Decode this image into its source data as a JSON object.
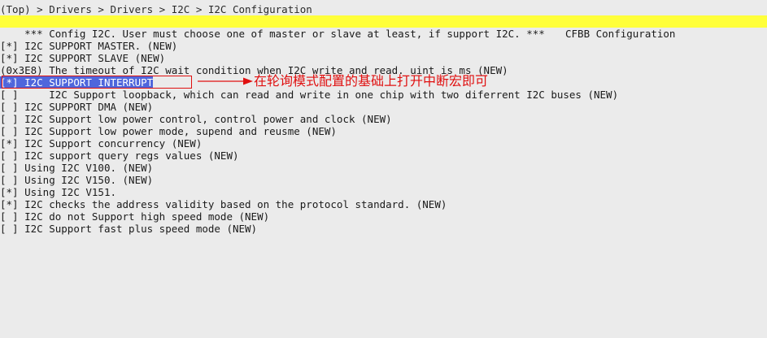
{
  "breadcrumb": "(Top) > Drivers > Drivers > I2C > I2C Configuration",
  "window_title": "CFBB Configuration",
  "items": [
    {
      "prefix": "    ",
      "text": "*** Config I2C. User must choose one of master or slave at least, if support I2C. ***"
    },
    {
      "prefix": "[*] ",
      "text": "I2C SUPPORT MASTER. (NEW)"
    },
    {
      "prefix": "[*] ",
      "text": "I2C SUPPORT SLAVE (NEW)"
    },
    {
      "prefix": "(0x3E8) ",
      "text": "The timeout of I2C wait condition when I2C write and read. uint is ms (NEW)"
    },
    {
      "prefix": "[*] ",
      "text": "I2C SUPPORT INTERRUPT"
    },
    {
      "prefix": "[ ]     ",
      "text": "I2C Support loopback, which can read and write in one chip with two diferrent I2C buses (NEW)"
    },
    {
      "prefix": "[ ] ",
      "text": "I2C SUPPORT DMA (NEW)"
    },
    {
      "prefix": "[ ] ",
      "text": "I2C Support low power control, control power and clock (NEW)"
    },
    {
      "prefix": "[ ] ",
      "text": "I2C Support low power mode, supend and reusme (NEW)"
    },
    {
      "prefix": "[*] ",
      "text": "I2C Support concurrency (NEW)"
    },
    {
      "prefix": "[ ] ",
      "text": "I2C support query regs values (NEW)"
    },
    {
      "prefix": "[ ] ",
      "text": "Using I2C V100. (NEW)"
    },
    {
      "prefix": "[ ] ",
      "text": "Using I2C V150. (NEW)"
    },
    {
      "prefix": "[*] ",
      "text": "Using I2C V151."
    },
    {
      "prefix": "[*] ",
      "text": "I2C checks the address validity based on the protocol standard. (NEW)"
    },
    {
      "prefix": "[ ] ",
      "text": "I2C do not Support high speed mode (NEW)"
    },
    {
      "prefix": "[ ] ",
      "text": "I2C Support fast plus speed mode (NEW)"
    }
  ],
  "selected_index": 4,
  "annotation": {
    "text": "在轮询模式配置的基础上打开中断宏即可",
    "color": "#e01010"
  },
  "colors": {
    "background": "#ebebeb",
    "title_bar": "#ffff3a",
    "selection": "#4f66dc"
  }
}
